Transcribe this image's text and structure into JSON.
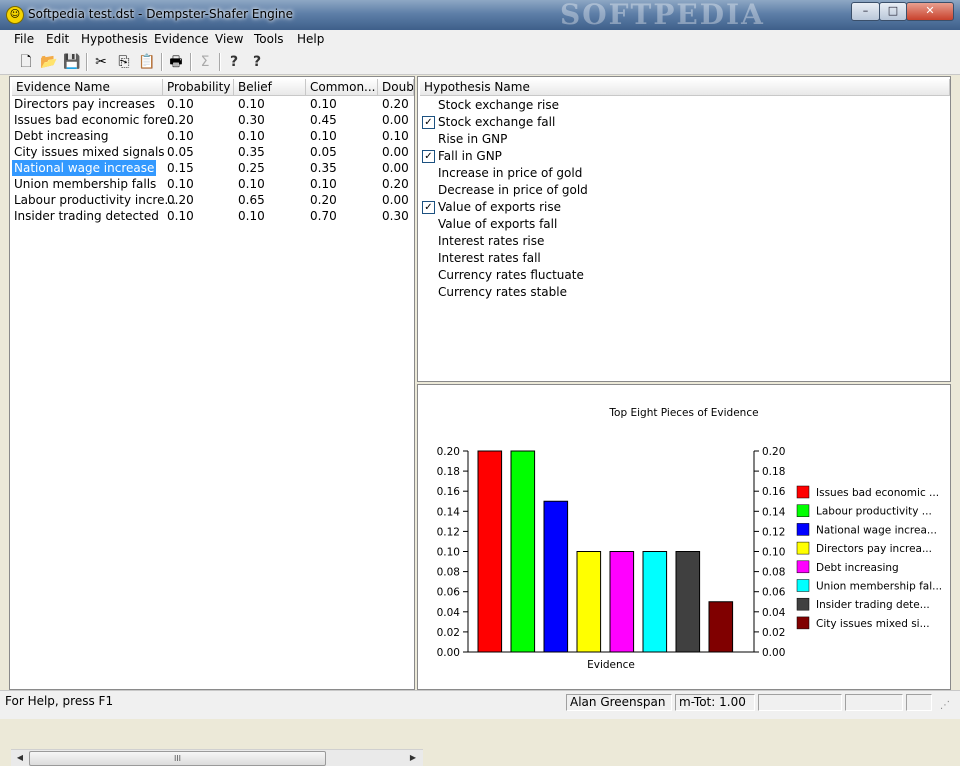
{
  "window": {
    "title": "Softpedia test.dst - Dempster-Shafer Engine",
    "watermark": "SOFTPEDIA",
    "controls": {
      "minimize": "–",
      "maximize": "□",
      "close": "✕"
    }
  },
  "menu": [
    "File",
    "Edit",
    "Hypothesis",
    "Evidence",
    "View",
    "Tools",
    "Help"
  ],
  "toolbar": {
    "new": "🗋",
    "open": "📂",
    "save": "💾",
    "cut": "✂",
    "copy": "⎘",
    "paste": "📋",
    "print": "🖶",
    "sum": "Σ",
    "help": "?",
    "context_help": "?",
    "icons": [
      "new-file-icon",
      "open-folder-icon",
      "save-icon",
      "cut-icon",
      "copy-icon",
      "paste-icon",
      "print-icon",
      "sum-icon",
      "help-icon",
      "context-help-icon"
    ]
  },
  "evidence_table": {
    "headers": [
      "Evidence Name",
      "Probability",
      "Belief",
      "Common...",
      "Doub"
    ],
    "rows": [
      [
        "Directors pay increases",
        "0.10",
        "0.10",
        "0.10",
        "0.20"
      ],
      [
        "Issues bad economic fore...",
        "0.20",
        "0.30",
        "0.45",
        "0.00"
      ],
      [
        "Debt increasing",
        "0.10",
        "0.10",
        "0.10",
        "0.10"
      ],
      [
        "City issues mixed signals",
        "0.05",
        "0.35",
        "0.05",
        "0.00"
      ],
      [
        "National wage increase",
        "0.15",
        "0.25",
        "0.35",
        "0.00"
      ],
      [
        "Union membership falls",
        "0.10",
        "0.10",
        "0.10",
        "0.20"
      ],
      [
        "Labour productivity incre...",
        "0.20",
        "0.65",
        "0.20",
        "0.00"
      ],
      [
        "Insider trading detected",
        "0.10",
        "0.10",
        "0.70",
        "0.30"
      ]
    ],
    "selected_row": 4,
    "scroll_grip": "III"
  },
  "hypothesis_list": {
    "header": "Hypothesis Name",
    "items": [
      {
        "label": "Stock exchange rise",
        "checked": false
      },
      {
        "label": "Stock exchange fall",
        "checked": true
      },
      {
        "label": "Rise in GNP",
        "checked": false
      },
      {
        "label": "Fall in GNP",
        "checked": true
      },
      {
        "label": "Increase in price of gold",
        "checked": false
      },
      {
        "label": "Decrease in price of gold",
        "checked": false
      },
      {
        "label": "Value of exports rise",
        "checked": true
      },
      {
        "label": "Value of exports fall",
        "checked": false
      },
      {
        "label": "Interest rates rise",
        "checked": false
      },
      {
        "label": "Interest rates fall",
        "checked": false
      },
      {
        "label": "Currency rates fluctuate",
        "checked": false
      },
      {
        "label": "Currency rates stable",
        "checked": false
      }
    ],
    "check_glyph": "✓"
  },
  "chart_data": {
    "type": "bar",
    "title": "Top Eight Pieces of Evidence",
    "xlabel": "Evidence",
    "ylabel": "",
    "ylim": [
      0,
      0.2
    ],
    "yticks": [
      "0.00",
      "0.02",
      "0.04",
      "0.06",
      "0.08",
      "0.10",
      "0.12",
      "0.14",
      "0.16",
      "0.18",
      "0.20"
    ],
    "legend_position": "right",
    "categories": [
      "Issues bad economic ...",
      "Labour productivity ...",
      "National wage increa...",
      "Directors pay increa...",
      "Debt increasing",
      "Union membership fal...",
      "Insider trading dete...",
      "City issues mixed si..."
    ],
    "values": [
      0.2,
      0.2,
      0.15,
      0.1,
      0.1,
      0.1,
      0.1,
      0.05
    ],
    "colors": [
      "#ff0000",
      "#00ff00",
      "#0000ff",
      "#ffff00",
      "#ff00ff",
      "#00ffff",
      "#404040",
      "#800000"
    ]
  },
  "status": {
    "help_text": "For Help, press F1",
    "user": "Alan Greenspan",
    "mtot": "m-Tot: 1.00"
  }
}
